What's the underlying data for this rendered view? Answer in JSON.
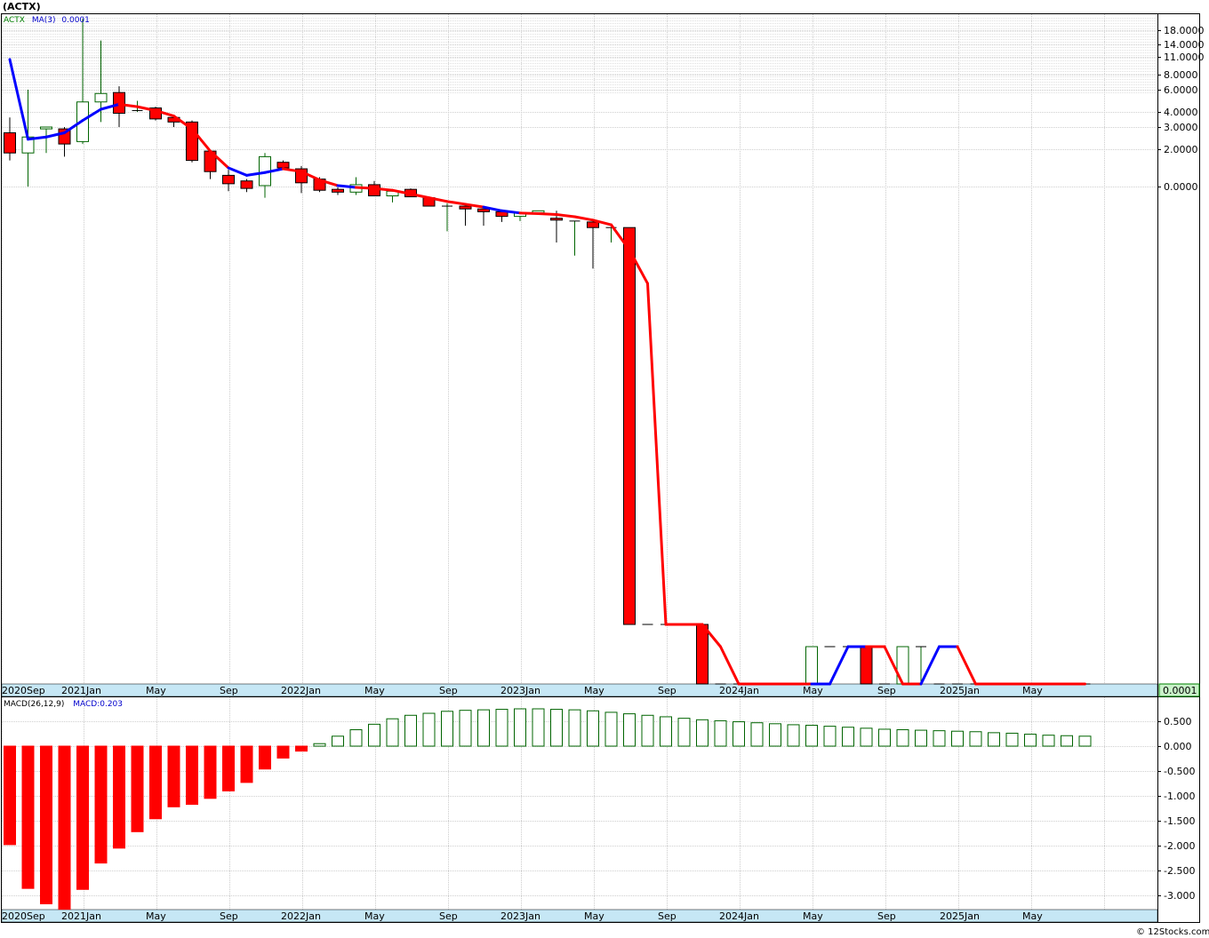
{
  "page": {
    "title": "(ACTX)",
    "footer": "© 12Stocks.com"
  },
  "colors": {
    "down_candle": "#ff0000",
    "up_candle": "#ffffff",
    "up_border": "#006400",
    "ma_rising": "#0000ff",
    "ma_falling": "#ff0000",
    "axis_band": "#c6e7f5",
    "last_price_box": "#c9f2c9",
    "grid": "#c0c0c0"
  },
  "chart_data": [
    {
      "type": "candlestick",
      "legend": {
        "symbol": "ACTX",
        "ma_label": "MA(3)",
        "ma_value": "0.0001"
      },
      "price_axis_labels": [
        "18.0000",
        "14.0000",
        "11.0000",
        "8.0000",
        "6.0000",
        "4.0000",
        "3.0000",
        "2.0000",
        "0.0000"
      ],
      "last_price_label": "0.0001",
      "x_labels": [
        "2020Sep",
        "2021Jan",
        "May",
        "Sep",
        "2022Jan",
        "May",
        "Sep",
        "2023Jan",
        "May",
        "Sep",
        "2024Jan",
        "May",
        "Sep",
        "2025Jan",
        "May"
      ],
      "candles": [
        {
          "o": 2.7,
          "h": 3.6,
          "l": 1.4,
          "c": 1.8
        },
        {
          "o": 1.8,
          "h": 6.0,
          "l": 0.0,
          "c": 2.5
        },
        {
          "o": 2.9,
          "h": 3.0,
          "l": 1.8,
          "c": 3.0
        },
        {
          "o": 2.9,
          "h": 3.0,
          "l": 1.6,
          "c": 2.2
        },
        {
          "o": 2.3,
          "h": 22.0,
          "l": 2.2,
          "c": 4.8
        },
        {
          "o": 4.8,
          "h": 15.0,
          "l": 3.3,
          "c": 5.6
        },
        {
          "o": 5.7,
          "h": 6.4,
          "l": 3.0,
          "c": 3.9
        },
        {
          "o": 4.1,
          "h": 4.9,
          "l": 4.0,
          "c": 4.1
        },
        {
          "o": 4.3,
          "h": 4.4,
          "l": 3.4,
          "c": 3.5
        },
        {
          "o": 3.6,
          "h": 3.7,
          "l": 3.0,
          "c": 3.3
        },
        {
          "o": 3.3,
          "h": 3.4,
          "l": 1.3,
          "c": 1.4
        },
        {
          "o": 1.9,
          "h": 1.9,
          "l": 0.4,
          "c": 0.8
        },
        {
          "o": 0.6,
          "h": 0.9,
          "l": -0.25,
          "c": 0.15
        },
        {
          "o": 0.3,
          "h": 0.4,
          "l": -0.3,
          "c": -0.1
        },
        {
          "o": 0.05,
          "h": 1.8,
          "l": -0.6,
          "c": 1.6
        },
        {
          "o": 1.3,
          "h": 1.4,
          "l": 0.95,
          "c": 1.0
        },
        {
          "o": 0.95,
          "h": 1.1,
          "l": -0.35,
          "c": 0.2
        },
        {
          "o": 0.4,
          "h": 0.5,
          "l": -0.3,
          "c": -0.2
        },
        {
          "o": -0.15,
          "h": -0.05,
          "l": -0.45,
          "c": -0.3
        },
        {
          "o": -0.3,
          "h": 0.5,
          "l": -0.45,
          "c": 0.1
        },
        {
          "o": 0.1,
          "h": 0.3,
          "l": -0.5,
          "c": -0.5
        },
        {
          "o": -0.5,
          "h": -0.2,
          "l": -0.85,
          "c": -0.25
        },
        {
          "o": -0.15,
          "h": -0.1,
          "l": -0.55,
          "c": -0.55
        },
        {
          "o": -0.6,
          "h": -0.6,
          "l": -1.05,
          "c": -1.05
        },
        {
          "o": -1.05,
          "h": -0.9,
          "l": -2.4,
          "c": -1.05
        },
        {
          "o": -1.05,
          "h": -1.05,
          "l": -2.1,
          "c": -1.2
        },
        {
          "o": -1.2,
          "h": -1.2,
          "l": -2.1,
          "c": -1.35
        },
        {
          "o": -1.35,
          "h": -1.3,
          "l": -1.9,
          "c": -1.6
        },
        {
          "o": -1.6,
          "h": -1.4,
          "l": -1.85,
          "c": -1.4
        },
        {
          "o": -1.4,
          "h": -1.3,
          "l": -1.4,
          "c": -1.3
        },
        {
          "o": -1.7,
          "h": -1.3,
          "l": -3.0,
          "c": -1.8
        },
        {
          "o": -1.85,
          "h": -1.85,
          "l": -3.7,
          "c": -1.85
        },
        {
          "o": -1.9,
          "h": -1.9,
          "l": -4.4,
          "c": -2.2
        },
        {
          "o": -2.2,
          "h": -2.2,
          "l": -3.0,
          "c": -2.2
        },
        {
          "o": -2.2,
          "h": -2.2,
          "l": -9.2,
          "c": -9.2
        },
        {
          "o": -9.2,
          "h": -9.2,
          "l": -9.2,
          "c": -9.2
        },
        {
          "o": -9.2,
          "h": -9.2,
          "l": -9.2,
          "c": -9.2
        },
        {
          "o": -9.2,
          "h": -9.2,
          "l": -9.2,
          "c": -9.2
        },
        {
          "o": -9.2,
          "h": -9.1,
          "l": -10.0,
          "c": -10.0
        },
        {
          "o": -10.0,
          "h": -10.0,
          "l": -10.0,
          "c": -10.0
        },
        {
          "o": -10.0,
          "h": -10.0,
          "l": -10.0,
          "c": -10.0
        },
        {
          "o": -10.0,
          "h": -10.0,
          "l": -10.0,
          "c": -10.0
        },
        {
          "o": -10.0,
          "h": -10.0,
          "l": -10.0,
          "c": -10.0
        },
        {
          "o": -10.0,
          "h": -10.0,
          "l": -10.0,
          "c": -10.0
        },
        {
          "o": -10.0,
          "h": -9.6,
          "l": -10.0,
          "c": -9.6
        },
        {
          "o": -9.6,
          "h": -9.6,
          "l": -9.6,
          "c": -9.6
        },
        {
          "o": -9.6,
          "h": -9.6,
          "l": -9.6,
          "c": -9.6
        },
        {
          "o": -9.6,
          "h": -9.6,
          "l": -10.0,
          "c": -10.0
        },
        {
          "o": -10.0,
          "h": -10.0,
          "l": -10.0,
          "c": -10.0
        },
        {
          "o": -10.0,
          "h": -9.6,
          "l": -10.0,
          "c": -9.6
        },
        {
          "o": -9.6,
          "h": -9.6,
          "l": -10.0,
          "c": -9.6
        },
        {
          "o": -10.0,
          "h": -10.0,
          "l": -10.0,
          "c": -10.0
        },
        {
          "o": -10.0,
          "h": -10.0,
          "l": -10.0,
          "c": -10.0
        },
        {
          "o": -10.0,
          "h": -10.0,
          "l": -10.0,
          "c": -10.0
        },
        {
          "o": -10.0,
          "h": -10.0,
          "l": -10.0,
          "c": -10.0
        },
        {
          "o": -10.0,
          "h": -10.0,
          "l": -10.0,
          "c": -10.0
        },
        {
          "o": -10.0,
          "h": -10.0,
          "l": -10.0,
          "c": -10.0
        },
        {
          "o": -10.0,
          "h": -10.0,
          "l": -10.0,
          "c": -10.0
        },
        {
          "o": -10.0,
          "h": -10.0,
          "l": -10.0,
          "c": -10.0
        },
        {
          "o": -10.0,
          "h": -10.0,
          "l": -10.0,
          "c": -10.0
        }
      ],
      "ma": [
        10.5,
        2.4,
        2.5,
        2.7,
        3.4,
        4.2,
        4.6,
        4.4,
        4.1,
        3.7,
        2.9,
        1.9,
        1.0,
        0.6,
        0.75,
        0.95,
        0.8,
        0.35,
        0.05,
        -0.05,
        -0.1,
        -0.2,
        -0.4,
        -0.6,
        -0.8,
        -0.95,
        -1.1,
        -1.3,
        -1.42,
        -1.45,
        -1.5,
        -1.62,
        -1.8,
        -2.05,
        -3.4,
        -5.2,
        -9.2,
        -9.2,
        -9.35,
        -9.65,
        -10.0,
        -10.0,
        -10.0,
        -10.0,
        -10.0,
        -9.85,
        -9.72,
        -9.6,
        -9.75,
        -9.85,
        -9.85,
        -9.68,
        -9.68,
        -9.85,
        -10.0,
        -10.0,
        -10.0,
        -10.0,
        -10.0,
        -10.0
      ],
      "ma_color": [
        "r",
        "b",
        "b",
        "b",
        "b",
        "b",
        "b",
        "r",
        "r",
        "r",
        "r",
        "r",
        "r",
        "b",
        "b",
        "b",
        "r",
        "r",
        "r",
        "b",
        "r",
        "r",
        "r",
        "r",
        "r",
        "r",
        "r",
        "b",
        "b",
        "r",
        "r",
        "r",
        "r",
        "r",
        "r",
        "r",
        "r",
        "r",
        "r",
        "r",
        "r",
        "r",
        "r",
        "r",
        "r",
        "b",
        "b",
        "b",
        "r",
        "r",
        "r",
        "b",
        "b",
        "r",
        "r",
        "r",
        "r",
        "r",
        "r",
        "r"
      ]
    },
    {
      "type": "bar",
      "legend": {
        "label": "MACD(26,12,9)",
        "value_label": "MACD:0.203"
      },
      "ylim": [
        -3.3,
        0.7
      ],
      "y_tick_labels": [
        "0.500",
        "0.000",
        "-0.500",
        "-1.000",
        "-1.500",
        "-2.000",
        "-2.500",
        "-3.000"
      ],
      "y_tick_values": [
        0.5,
        0.0,
        -0.5,
        -1.0,
        -1.5,
        -2.0,
        -2.5,
        -3.0
      ],
      "x_labels": [
        "2020Sep",
        "2021Jan",
        "May",
        "Sep",
        "2022Jan",
        "May",
        "Sep",
        "2023Jan",
        "May",
        "Sep",
        "2024Jan",
        "May",
        "Sep",
        "2025Jan",
        "May"
      ],
      "values": [
        -1.98,
        -2.86,
        -3.17,
        -3.28,
        -2.88,
        -2.35,
        -2.05,
        -1.72,
        -1.46,
        -1.22,
        -1.17,
        -1.05,
        -0.9,
        -0.73,
        -0.46,
        -0.24,
        -0.1,
        0.05,
        0.2,
        0.33,
        0.44,
        0.55,
        0.62,
        0.66,
        0.7,
        0.72,
        0.73,
        0.74,
        0.75,
        0.75,
        0.74,
        0.73,
        0.71,
        0.68,
        0.65,
        0.62,
        0.59,
        0.56,
        0.53,
        0.51,
        0.49,
        0.47,
        0.45,
        0.43,
        0.42,
        0.4,
        0.38,
        0.36,
        0.34,
        0.33,
        0.32,
        0.31,
        0.3,
        0.29,
        0.27,
        0.26,
        0.24,
        0.22,
        0.21,
        0.2
      ]
    }
  ]
}
